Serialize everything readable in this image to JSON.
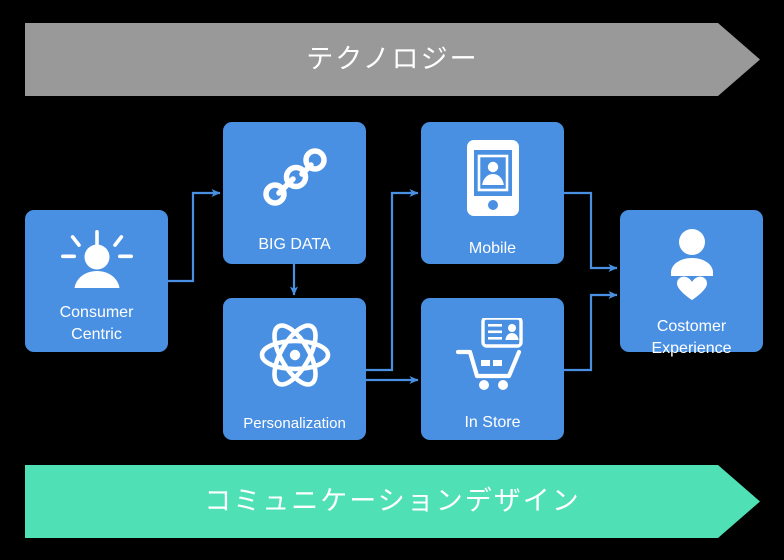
{
  "diagram": {
    "title_top": "テクノロジー",
    "title_bottom": "コミュニケーションデザイン",
    "colors": {
      "background": "#000000",
      "node": "#4a90e2",
      "connector": "#4a90e2",
      "banner_top": "#999999",
      "banner_bottom": "#4fe0b5",
      "text": "#ffffff"
    },
    "banners": [
      {
        "name": "technology",
        "label": "テクノロジー",
        "color": "#999999",
        "position": "top"
      },
      {
        "name": "communication-design",
        "label": "コミュニケーションデザイン",
        "color": "#4fe0b5",
        "position": "bottom"
      }
    ],
    "nodes": [
      {
        "id": "consumer-centric",
        "label": "Consumer\nCentric",
        "label_line1": "Consumer",
        "label_line2": "Centric",
        "icon": "person-with-rays-icon"
      },
      {
        "id": "big-data",
        "label": "BIG DATA",
        "icon": "connected-nodes-icon"
      },
      {
        "id": "personalization",
        "label": "Personalization",
        "icon": "atom-icon"
      },
      {
        "id": "mobile",
        "label": "Mobile",
        "icon": "smartphone-contact-icon"
      },
      {
        "id": "in-store",
        "label": "In Store",
        "icon": "shopping-cart-id-card-icon"
      },
      {
        "id": "costomer-experience",
        "label": "Costomer\nExperience",
        "label_line1": "Costomer",
        "label_line2": "Experience",
        "icon": "person-with-heart-icon"
      }
    ],
    "connections": [
      {
        "from": "consumer-centric",
        "to": "big-data"
      },
      {
        "from": "big-data",
        "to": "personalization"
      },
      {
        "from": "personalization",
        "to": "mobile"
      },
      {
        "from": "personalization",
        "to": "in-store"
      },
      {
        "from": "mobile",
        "to": "costomer-experience"
      },
      {
        "from": "in-store",
        "to": "costomer-experience"
      }
    ]
  }
}
